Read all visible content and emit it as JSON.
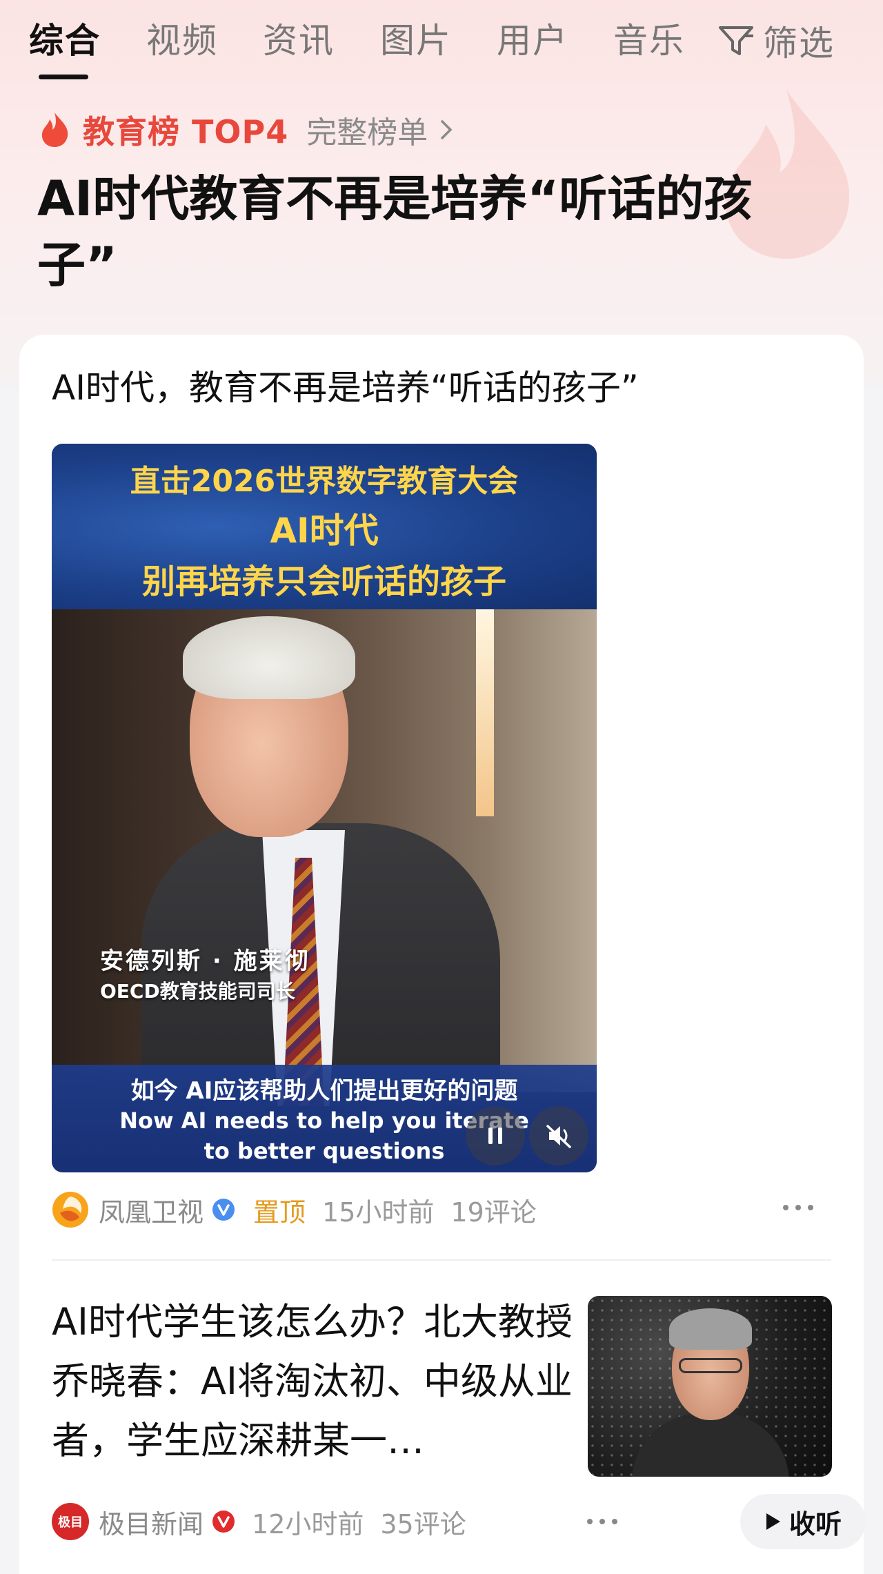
{
  "tabs": [
    {
      "label": "综合",
      "active": true
    },
    {
      "label": "视频"
    },
    {
      "label": "资讯"
    },
    {
      "label": "图片"
    },
    {
      "label": "用户"
    },
    {
      "label": "音乐"
    }
  ],
  "filter": {
    "label": "筛选",
    "icon": "filter-icon"
  },
  "ranking": {
    "title": "教育榜 TOP4",
    "link": "完整榜单",
    "accent": "#e8483c"
  },
  "headline": "AI时代教育不再是培养“听话的孩子”",
  "card1": {
    "title": "AI时代，教育不再是培养“听话的孩子”",
    "video": {
      "banner": [
        "直击2026世界数字教育大会",
        "AI时代",
        "别再培养只会听话的孩子"
      ],
      "caption_name": "安德列斯 · 施莱彻",
      "caption_title": "OECD教育技能司司长",
      "subtitle_cn": "如今 AI应该帮助人们提出更好的问题",
      "subtitle_en_1": "Now AI needs to help you iterate",
      "subtitle_en_2": "to better questions"
    },
    "source": "凤凰卫视",
    "pinned": "置顶",
    "time": "15小时前",
    "comments": "19评论"
  },
  "card2": {
    "title": "AI时代学生该怎么办？北大教授乔晓春：AI将淘汰初、中级从业者，学生应深耕某一…",
    "source": "极目新闻",
    "source_logo_text": "极目",
    "time": "12小时前",
    "comments": "35评论",
    "listen_label": "收听"
  }
}
